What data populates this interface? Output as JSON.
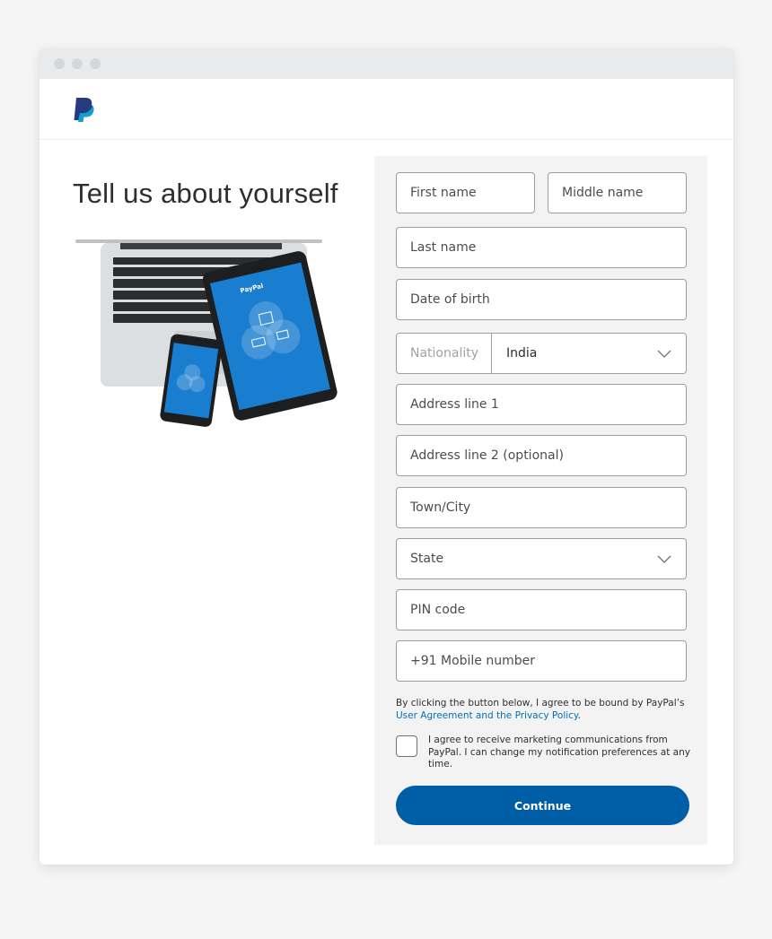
{
  "window": {
    "controls": [
      "close",
      "minimize",
      "maximize"
    ]
  },
  "header": {
    "logo": "paypal-logo"
  },
  "page": {
    "title": "Tell us about yourself",
    "hero_image": "laptop-tablet-phone-paypal-illustration"
  },
  "form": {
    "first_name": {
      "placeholder": "First name",
      "value": ""
    },
    "middle_name": {
      "placeholder": "Middle name",
      "value": ""
    },
    "last_name": {
      "placeholder": "Last name",
      "value": ""
    },
    "date_of_birth": {
      "placeholder": "Date of birth",
      "value": ""
    },
    "nationality": {
      "label": "Nationality",
      "selected": "India",
      "icon": "chevron-down-icon"
    },
    "address_line_1": {
      "placeholder": "Address line 1",
      "value": ""
    },
    "address_line_2": {
      "placeholder": "Address line 2 (optional)",
      "value": ""
    },
    "town_city": {
      "placeholder": "Town/City",
      "value": ""
    },
    "state": {
      "placeholder": "State",
      "icon": "chevron-down-icon"
    },
    "pin_code": {
      "placeholder": "PIN code",
      "value": ""
    },
    "mobile": {
      "placeholder": "+91 Mobile number",
      "value": ""
    },
    "legal_text": "By clicking the button below, I agree to be bound by PayPal’s",
    "legal_link": "User Agreement and the Privacy Policy",
    "legal_end": ".",
    "marketing_consent": {
      "checked": false,
      "label": "I agree to receive marketing communications from PayPal. I can change my notification preferences at any time."
    },
    "continue_label": "Continue"
  },
  "colors": {
    "primary_button": "#005ea6",
    "link": "#0070ba",
    "panel_bg": "#f3f3f3",
    "logo_dark": "#253b80",
    "logo_light": "#179bd7"
  }
}
